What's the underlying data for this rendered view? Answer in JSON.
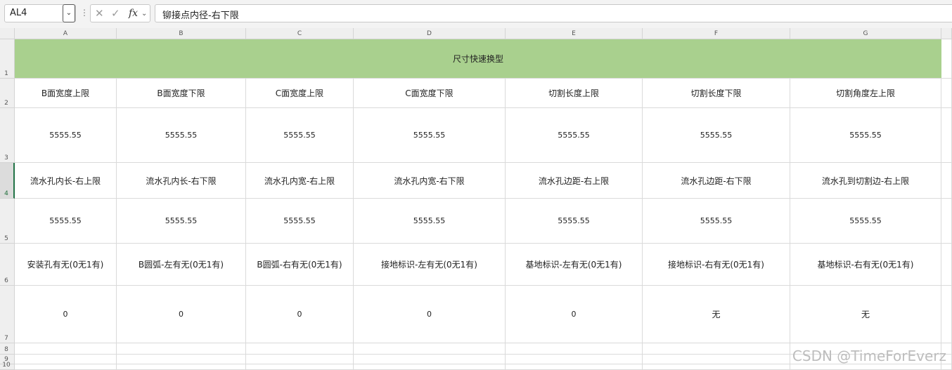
{
  "formula_bar": {
    "name_box": "AL4",
    "name_box_dropdown_icon": "chevron-down-icon",
    "more_icon": "more-vertical-icon",
    "cancel_icon": "close-icon",
    "confirm_icon": "check-icon",
    "fx_label": "fx",
    "content": "铆接点内径-右下限"
  },
  "columns": [
    "A",
    "B",
    "C",
    "D",
    "E",
    "F",
    "G"
  ],
  "rows": [
    "1",
    "2",
    "3",
    "4",
    "5",
    "6",
    "7",
    "8",
    "9",
    "10"
  ],
  "selected_row": "4",
  "title_cell": "尺寸快速换型",
  "grid": [
    [
      "B面宽度上限",
      "B面宽度下限",
      "C面宽度上限",
      "C面宽度下限",
      "切割长度上限",
      "切割长度下限",
      "切割角度左上限"
    ],
    [
      "5555.55",
      "5555.55",
      "5555.55",
      "5555.55",
      "5555.55",
      "5555.55",
      "5555.55"
    ],
    [
      "流水孔内长-右上限",
      "流水孔内长-右下限",
      "流水孔内宽-右上限",
      "流水孔内宽-右下限",
      "流水孔边距-右上限",
      "流水孔边距-右下限",
      "流水孔到切割边-右上限"
    ],
    [
      "5555.55",
      "5555.55",
      "5555.55",
      "5555.55",
      "5555.55",
      "5555.55",
      "5555.55"
    ],
    [
      "安装孔有无(0无1有)",
      "B圆弧-左有无(0无1有)",
      "B圆弧-右有无(0无1有)",
      "接地标识-左有无(0无1有)",
      "基地标识-左有无(0无1有)",
      "接地标识-右有无(0无1有)",
      "基地标识-右有无(0无1有)"
    ],
    [
      "0",
      "0",
      "0",
      "0",
      "0",
      "无",
      "无"
    ]
  ],
  "watermark": "CSDN @TimeForEverz",
  "colors": {
    "title_fill": "#a9d08e",
    "selection_accent": "#217346"
  }
}
